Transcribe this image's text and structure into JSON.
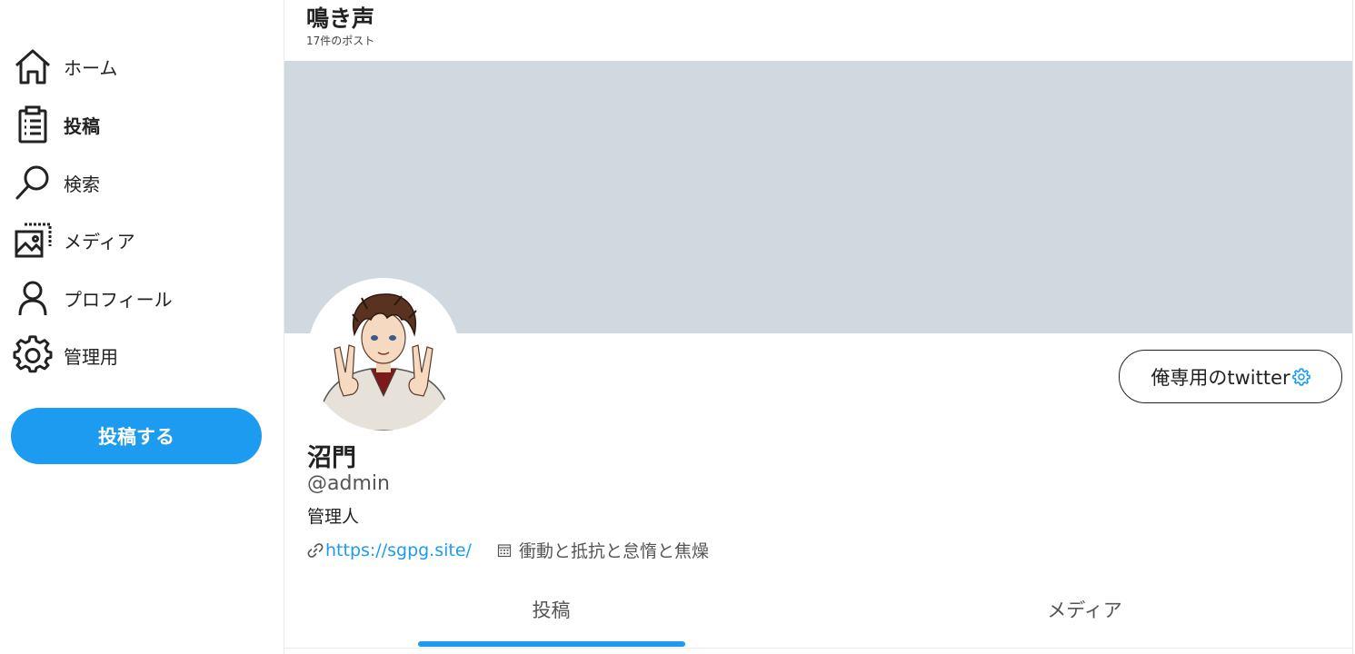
{
  "sidebar": {
    "items": [
      {
        "label": "ホーム",
        "icon": "home-icon"
      },
      {
        "label": "投稿",
        "icon": "clipboard-list-icon",
        "active": true
      },
      {
        "label": "検索",
        "icon": "search-icon"
      },
      {
        "label": "メディア",
        "icon": "media-images-icon"
      },
      {
        "label": "プロフィール",
        "icon": "user-icon"
      },
      {
        "label": "管理用",
        "icon": "gear-icon"
      }
    ],
    "post_button_label": "投稿する"
  },
  "header": {
    "title": "鳴き声",
    "post_count": "17件のポスト"
  },
  "profile": {
    "name": "沼門",
    "handle": "@admin",
    "bio": "管理人",
    "link": "https://sgpg.site/",
    "tagline": "衝動と抵抗と怠惰と焦燥",
    "action_button_label": "俺専用のtwitter"
  },
  "tabs": [
    {
      "label": "投稿",
      "active": true
    },
    {
      "label": "メディア",
      "active": false
    }
  ],
  "colors": {
    "accent": "#1d9bf0",
    "banner": "#cfd9df",
    "text": "#222222",
    "muted": "#555555"
  }
}
